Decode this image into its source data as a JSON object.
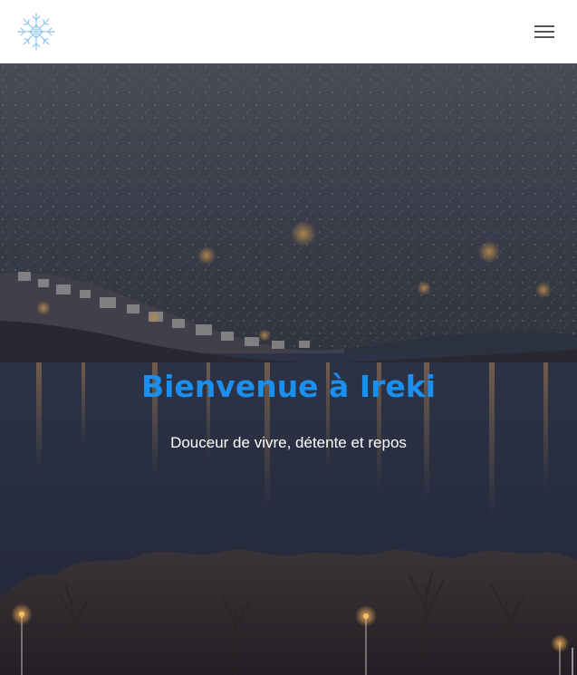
{
  "header": {
    "logo_icon": "snowflake-icon",
    "menu_icon": "hamburger-menu-icon"
  },
  "hero": {
    "title": "Bienvenue à Ireki",
    "subtitle": "Douceur de vivre, détente et repos"
  },
  "colors": {
    "title": "#1a8fee",
    "subtitle": "#ffffff",
    "header_bg": "#ffffff",
    "logo": "#8cc8e8",
    "menu_lines": "#555555"
  }
}
